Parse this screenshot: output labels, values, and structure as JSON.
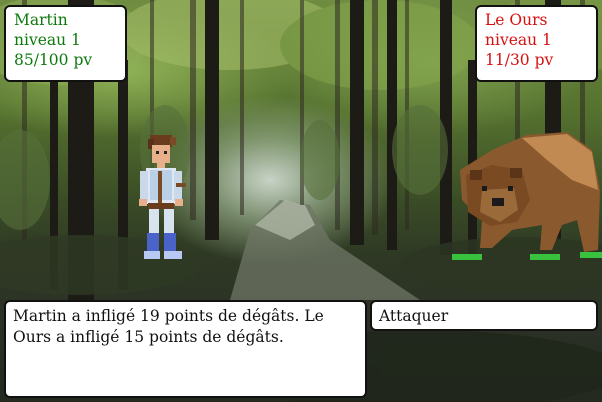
{
  "player": {
    "name": "Martin",
    "level": "niveau 1",
    "hp_text": "85/100 pv",
    "hp_current": 85,
    "hp_max": 100,
    "color": "#0c7a0c"
  },
  "enemy": {
    "name": "Le Ours",
    "level": "niveau 1",
    "hp_text": "11/30 pv",
    "hp_current": 11,
    "hp_max": 30,
    "color": "#d61010"
  },
  "message": "Martin a infligé 19 points de dégâts. Le Ours a infligé 15 points de dégâts.",
  "actions": {
    "attack_label": "Attaquer"
  }
}
